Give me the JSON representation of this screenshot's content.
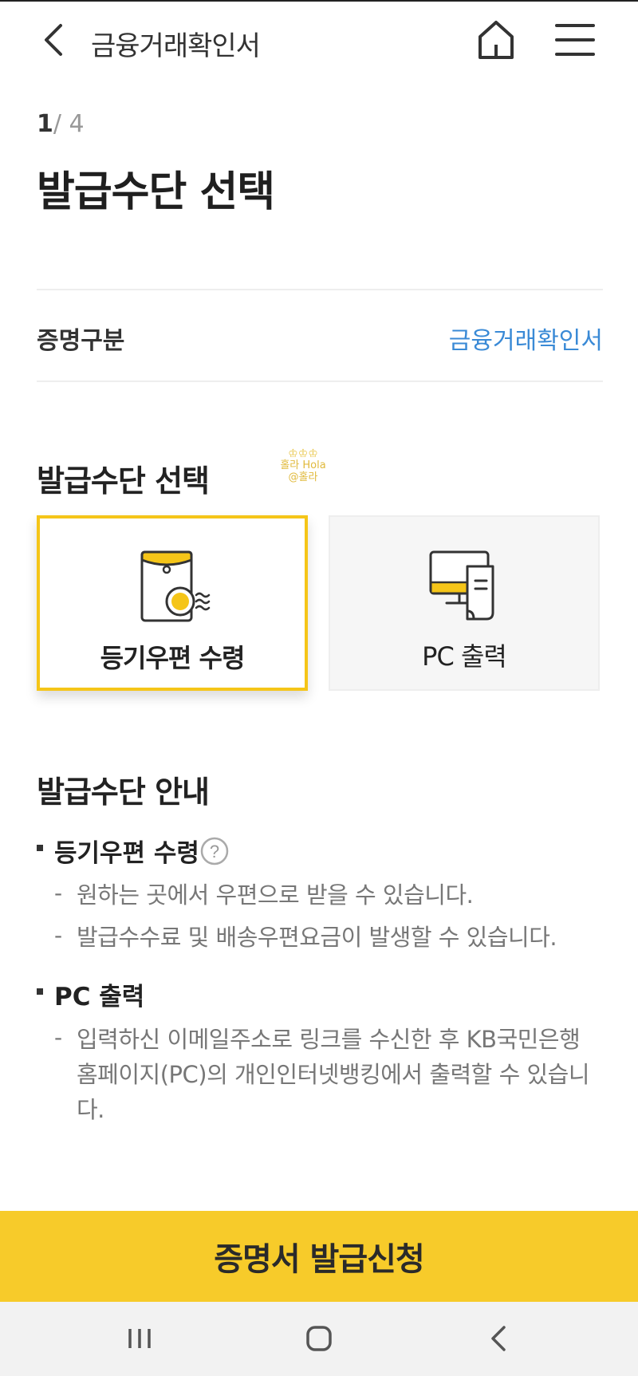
{
  "header": {
    "title": "금융거래확인서",
    "back_icon": "chevron-left-icon",
    "home_icon": "home-icon",
    "menu_icon": "hamburger-menu-icon"
  },
  "step": {
    "current": "1",
    "total": "/ 4"
  },
  "page_title": "발급수단 선택",
  "certificate": {
    "label": "증명구분",
    "value": "금융거래확인서"
  },
  "method_section": {
    "title": "발급수단 선택",
    "options": [
      {
        "label": "등기우편 수령",
        "icon": "registered-mail-icon",
        "selected": true
      },
      {
        "label": "PC 출력",
        "icon": "pc-print-icon",
        "selected": false
      }
    ]
  },
  "watermark": {
    "line1": "홀라 Hola",
    "line2": "@홀라"
  },
  "guide": {
    "title": "발급수단 안내",
    "mail": {
      "title": "등기우편 수령",
      "help_icon": "question-circle-icon",
      "lines": [
        "원하는 곳에서 우편으로 받을 수 있습니다.",
        "발급수수료 및 배송우편요금이 발생할 수 있습니다."
      ]
    },
    "pc": {
      "title": "PC 출력",
      "lines": [
        "입력하신 이메일주소로 링크를 수신한 후 KB국민은행 홈페이지(PC)의 개인인터넷뱅킹에서 출력할 수 있습니다."
      ]
    }
  },
  "cta": {
    "label": "증명서 발급신청"
  },
  "colors": {
    "accent": "#f7cb2a",
    "link": "#3a8ad6",
    "selected_border": "#f5c518"
  },
  "system_nav": {
    "recent_icon": "recent-apps-icon",
    "home_icon": "nav-home-icon",
    "back_icon": "nav-back-icon"
  }
}
